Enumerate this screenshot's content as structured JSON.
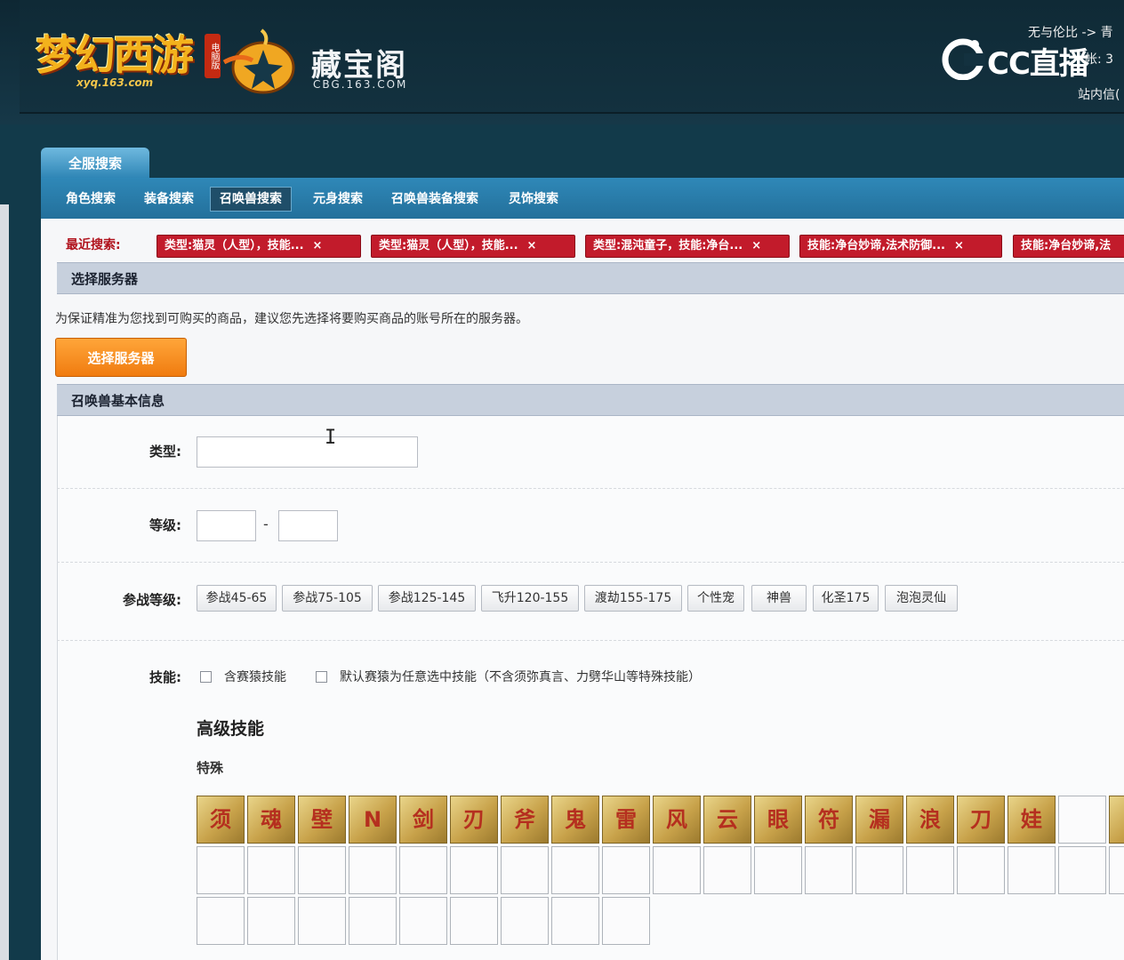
{
  "header": {
    "game_logo": "梦幻西游",
    "game_logo_tag": "电脑版",
    "game_logo_sub": "xyq.163.com",
    "cbg_title": "藏宝阁",
    "cbg_sub": "CBG.163.COM",
    "cc_logo": "CC直播",
    "top_right_line1": "无与伦比 -> 青",
    "top_right_line2": "帐: 3",
    "top_right_line3": "站内信("
  },
  "tabs": {
    "main": "全服搜索"
  },
  "subnav": [
    {
      "label": "角色搜索"
    },
    {
      "label": "装备搜索"
    },
    {
      "label": "召唤兽搜索"
    },
    {
      "label": "元身搜索"
    },
    {
      "label": "召唤兽装备搜索"
    },
    {
      "label": "灵饰搜索"
    }
  ],
  "recent": {
    "label": "最近搜索:",
    "chips": [
      "类型:猫灵（人型），技能...",
      "类型:猫灵（人型），技能...",
      "类型:混沌童子，技能:净台...",
      "技能:净台妙谛,法术防御...",
      "技能:净台妙谛,法"
    ],
    "close": "×"
  },
  "server": {
    "title": "选择服务器",
    "note": "为保证精准为您找到可购买的商品，建议您先选择将要购买商品的账号所在的服务器。",
    "button": "选择服务器"
  },
  "pet_info": {
    "title": "召唤兽基本信息",
    "type_label": "类型:",
    "type_value": "",
    "level_label": "等级:",
    "level_min": "",
    "level_max": "",
    "level_dash": "-",
    "battle_label": "参战等级:",
    "battle_levels": [
      "参战45-65",
      "参战75-105",
      "参战125-145",
      "飞升120-155",
      "渡劫155-175",
      "个性宠",
      "神兽",
      "化圣175",
      "泡泡灵仙"
    ],
    "skill_label": "技能:",
    "skill_opt1": "含赛猿技能",
    "skill_opt2": "默认赛猿为任意选中技能（不含须弥真言、力劈华山等特殊技能）",
    "advanced_title": "高级技能",
    "special_title": "特殊"
  },
  "skill_icons": [
    "须",
    "魂",
    "壁",
    "N",
    "剑",
    "刃",
    "斧",
    "鬼",
    "雷",
    "风",
    "云",
    "眼",
    "符",
    "漏",
    "浪",
    "刀",
    "娃"
  ]
}
